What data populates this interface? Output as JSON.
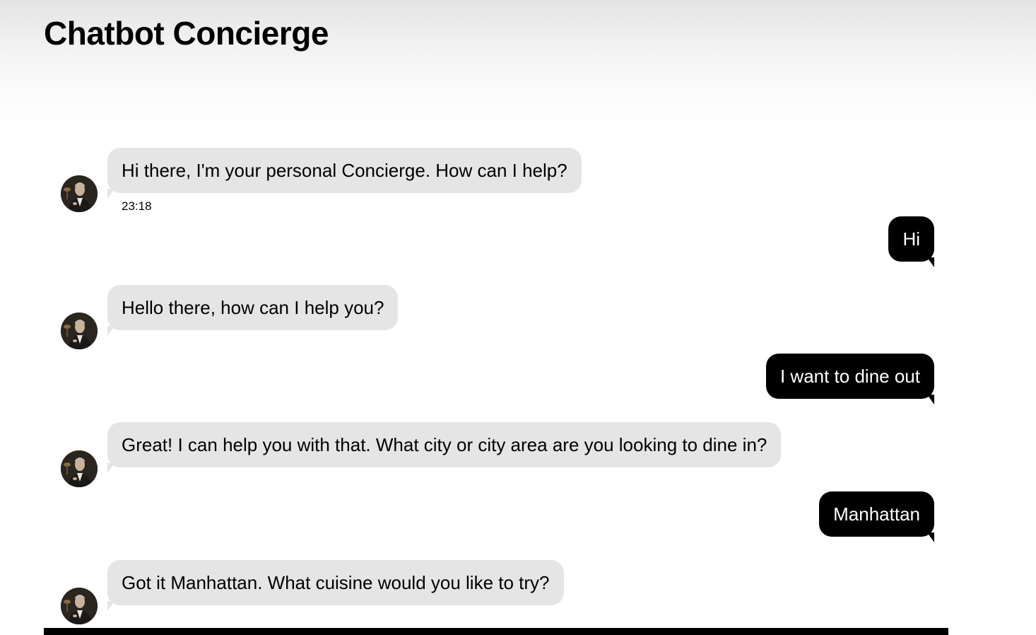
{
  "app": {
    "title": "Chatbot Concierge"
  },
  "messages": [
    {
      "sender": "bot",
      "text": "Hi there, I'm your personal Concierge. How can I help?",
      "time": "23:18"
    },
    {
      "sender": "user",
      "text": "Hi"
    },
    {
      "sender": "bot",
      "text": "Hello there, how can I help you?"
    },
    {
      "sender": "user",
      "text": "I want to dine out"
    },
    {
      "sender": "bot",
      "text": "Great! I can help you with that. What city or city area are you looking to dine in?"
    },
    {
      "sender": "user",
      "text": "Manhattan"
    },
    {
      "sender": "bot",
      "text": "Got it Manhattan. What cuisine would you like to try?"
    }
  ],
  "colors": {
    "bot_bubble": "#e5e5e5",
    "user_bubble": "#000000",
    "user_text": "#ffffff",
    "bottom_bar": "#000000"
  },
  "icons": {
    "bot_avatar": "concierge-avatar-icon"
  }
}
